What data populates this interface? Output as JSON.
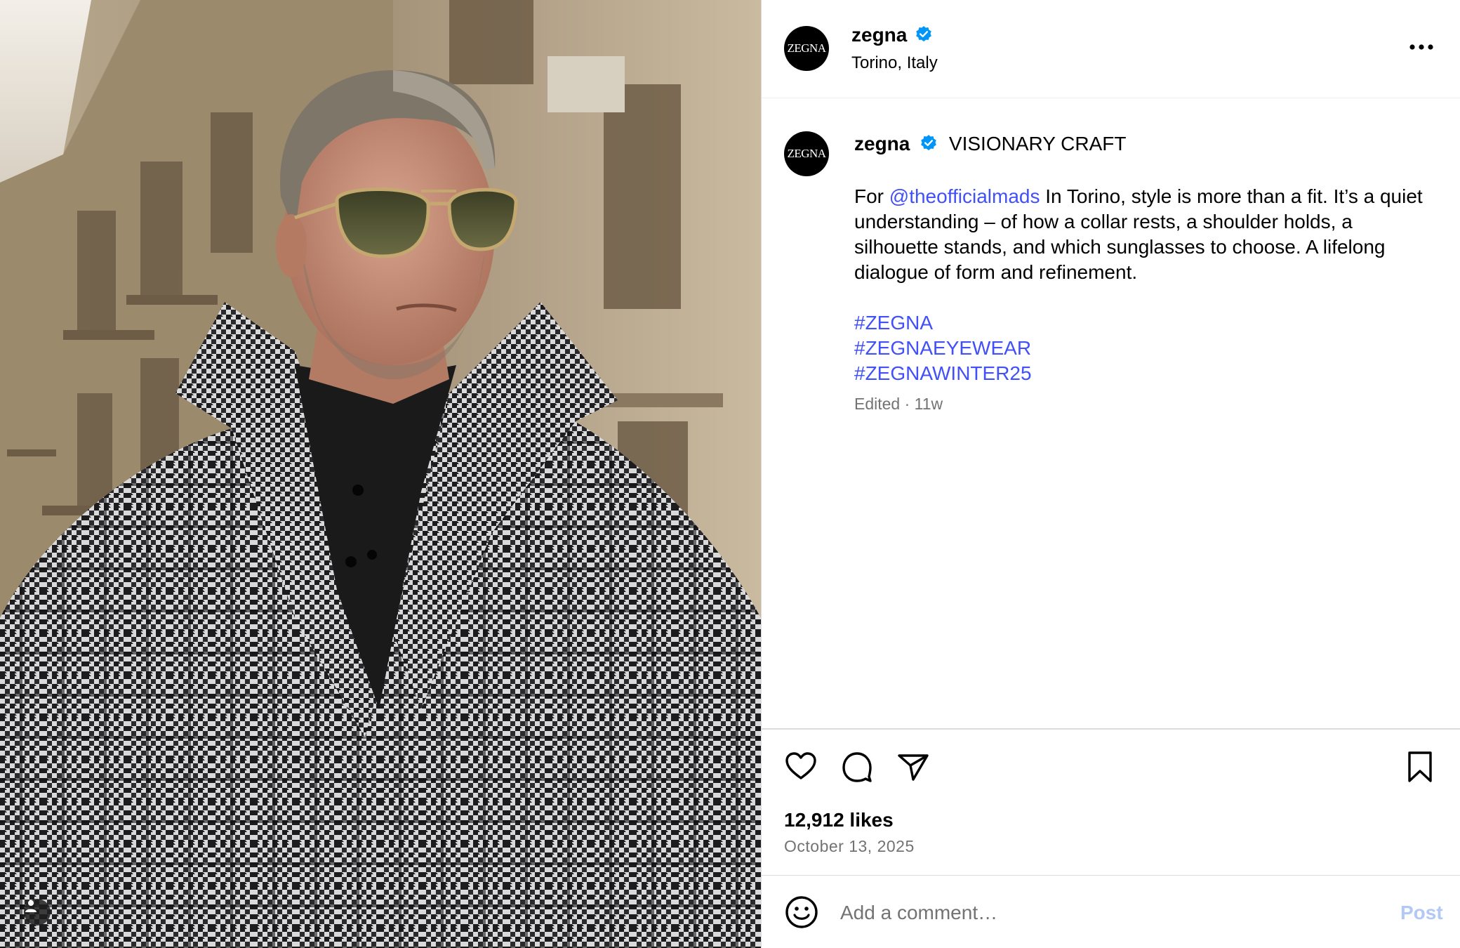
{
  "photo": {
    "alt": "Man in houndstooth overcoat and aviator sunglasses on a street",
    "tag_icon": "person-icon"
  },
  "header": {
    "avatar_text": "ZEGNA",
    "username": "zegna",
    "verified_icon": "verified-badge-icon",
    "location": "Torino, Italy",
    "more_icon": "more-options-icon"
  },
  "caption": {
    "avatar_text": "ZEGNA",
    "username": "zegna",
    "title": "VISIONARY CRAFT",
    "text_prefix": "For ",
    "mention": "@theofficialmads",
    "text_rest": " In Torino, style is more than a fit. It’s a quiet understanding – of how a collar rests, a shoulder holds, a silhouette stands, and which sunglasses to choose. A lifelong dialogue of form and refinement.",
    "hashtags": [
      "#ZEGNA",
      "#ZEGNAEYEWEAR",
      "#ZEGNAWINTER25"
    ],
    "meta": "Edited · 11w"
  },
  "actions": {
    "icons": [
      "heart-icon",
      "comment-icon",
      "share-icon",
      "bookmark-icon"
    ]
  },
  "likes": "12,912 likes",
  "date": "October 13, 2025",
  "comment": {
    "placeholder": "Add a comment…",
    "post_label": "Post",
    "emoji_icon": "emoji-icon"
  },
  "colors": {
    "link": "#4150f7",
    "verified": "#0095f6",
    "muted": "#737373",
    "post_disabled": "#b2c8f5"
  }
}
